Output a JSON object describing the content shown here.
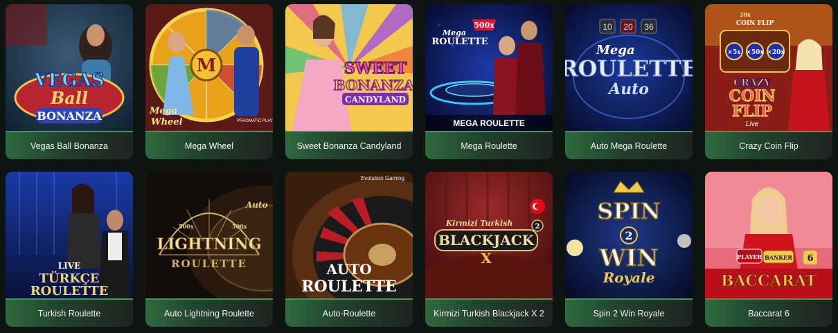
{
  "games": [
    {
      "name": "Vegas Ball Bonanza",
      "art": [
        "VEGAS",
        "Ball",
        "BONANZA"
      ]
    },
    {
      "name": "Mega Wheel",
      "art": [
        "M",
        "Mega",
        "Wheel",
        "PRAGMATIC PLAY"
      ]
    },
    {
      "name": "Sweet Bonanza Candyland",
      "art": [
        "SWEET",
        "BONANZA",
        "CANDYLAND"
      ]
    },
    {
      "name": "Mega Roulette",
      "art": [
        "500x",
        "Mega",
        "ROULETTE",
        "MEGA ROULETTE"
      ]
    },
    {
      "name": "Auto Mega Roulette",
      "art": [
        "10",
        "20",
        "36",
        "Mega",
        "ROULETTE",
        "Auto"
      ]
    },
    {
      "name": "Crazy Coin Flip",
      "art": [
        "20x",
        "COIN FLIP",
        "×5x",
        "×50x",
        "×20x",
        "CRAZY",
        "COIN",
        "FLIP",
        "Live"
      ]
    },
    {
      "name": "Turkish Roulette",
      "art": [
        "LIVE",
        "TÜRKÇE",
        "ROULETTE"
      ]
    },
    {
      "name": "Auto Lightning Roulette",
      "art": [
        "Auto",
        "500x",
        "500x",
        "LIGHTNING",
        "ROULETTE"
      ]
    },
    {
      "name": "Auto-Roulette",
      "art": [
        "Evolution Gaming",
        "AUTO",
        "ROULETTE"
      ]
    },
    {
      "name": "Kirmizi Turkish Blackjack X 2",
      "art": [
        "Kirmizi Turkish",
        "2",
        "BLACKJACK",
        "X"
      ]
    },
    {
      "name": "Spin 2 Win Royale",
      "art": [
        "SPIN",
        "2",
        "WIN",
        "Royale"
      ]
    },
    {
      "name": "Baccarat 6",
      "art": [
        "PLAYER",
        "BANKER",
        "6",
        "BACCARAT"
      ]
    }
  ],
  "colors": {
    "background": "#0f1612",
    "caption_accent": "#3f9a58",
    "caption_text": "#f1f1f1"
  }
}
